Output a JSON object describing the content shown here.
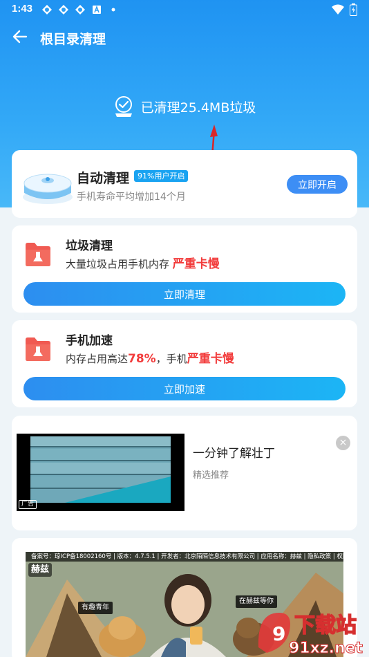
{
  "status_bar": {
    "time": "1:43"
  },
  "header": {
    "title": "根目录清理"
  },
  "result": {
    "text": "已清理25.4MB垃圾"
  },
  "auto_clean": {
    "title": "自动清理",
    "badge": "91%用户开启",
    "subtitle": "手机寿命平均增加14个月",
    "button": "立即开启"
  },
  "junk_clean": {
    "title": "垃圾清理",
    "desc_prefix": "大量垃圾占用手机内存 ",
    "desc_alert": "严重卡慢",
    "button": "立即清理"
  },
  "phone_speed": {
    "title": "手机加速",
    "desc_prefix": "内存占用高达",
    "desc_percent": "78%",
    "desc_middle": "，手机",
    "desc_alert": "严重卡慢",
    "button": "立即加速"
  },
  "ad": {
    "title": "一分钟了解壮丁",
    "subtitle": "精选推荐",
    "tag": "广告",
    "close": "×"
  },
  "banner": {
    "info": "备案号：琼ICP备18002160号 | 版本：4.7.5.1 | 开发者：北京陌陌信息技术有限公司 | 应用名称：赫兹 | 隐私政策 | 权限说明 | 用户协议",
    "logo": "赫兹",
    "label_left": "有趣青年",
    "label_right": "在赫兹等你"
  },
  "watermark": {
    "brand": "下载站",
    "url": "91xz.net"
  },
  "colors": {
    "accent": "#1f93f2",
    "alert": "#f23c3c",
    "button": "#3d8ef5"
  }
}
